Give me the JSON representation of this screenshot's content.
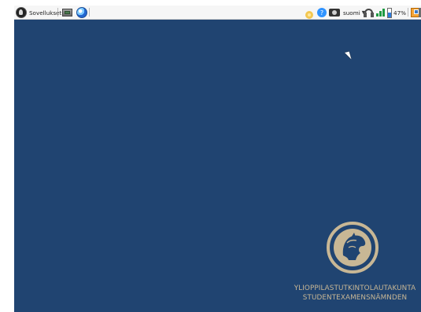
{
  "taskbar": {
    "apps_label": "Sovellukset",
    "language_label": "suomi",
    "battery_percent": 47,
    "battery_text": "47%"
  },
  "icons": {
    "apps": "app-menu-icon",
    "screenshot": "screenshot-icon",
    "browser": "browser-icon",
    "help": "help-icon",
    "camera": "camera-icon",
    "headphones": "headphones-icon",
    "wifi": "wifi-icon",
    "battery": "battery-icon",
    "window": "window-icon",
    "sun": "sun-icon"
  },
  "branding": {
    "line1": "YLIOPPILASTUTKINTOLAUTAKUNTA",
    "line2": "STUDENTEXAMENSNÄMNDEN"
  },
  "colors": {
    "desktop_bg": "#204471",
    "taskbar_bg": "#f6f6f6",
    "logo_gold": "#c8b795"
  }
}
